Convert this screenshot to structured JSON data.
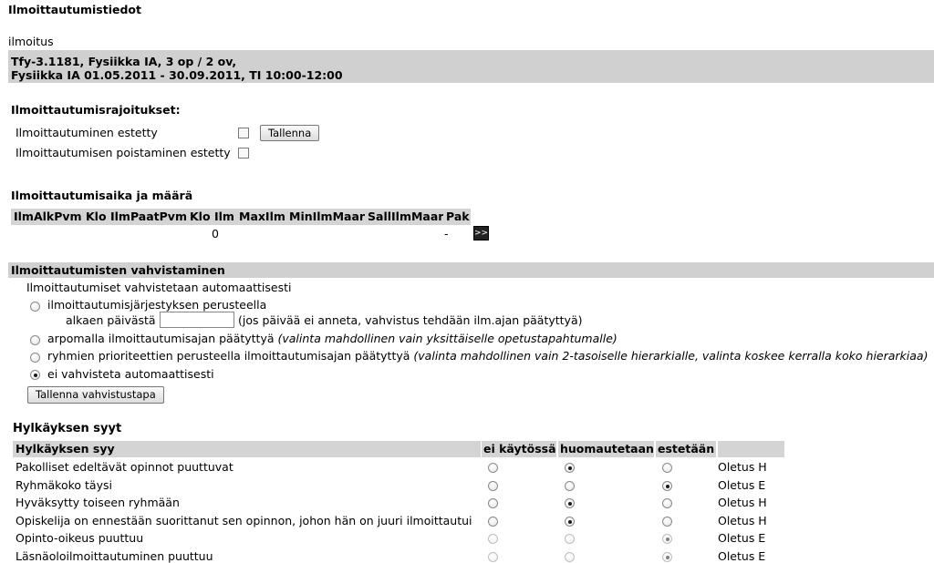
{
  "page_title": "Ilmoittautumistiedot",
  "subtitle": "ilmoitus",
  "course_info": {
    "line1": "Tfy-3.1181, Fysiikka IA, 3 op / 2 ov,",
    "line2": "Fysiikka IA 01.05.2011 - 30.09.2011, TI 10:00-12:00"
  },
  "restrictions": {
    "heading": "Ilmoittautumisrajoitukset:",
    "blocked_label": "Ilmoittautuminen estetty",
    "remove_blocked_label": "Ilmoittautumisen poistaminen estetty",
    "save_label": "Tallenna"
  },
  "period": {
    "heading": "Ilmoittautumisaika ja määrä",
    "columns": [
      "IlmAlkPvm",
      "Klo",
      "IlmPaatPvm",
      "Klo",
      "Ilm",
      "MaxIlm",
      "MinIlmMaar",
      "SallIlmMaar",
      "Pak"
    ],
    "row": {
      "ilm": "0",
      "pak": "-"
    },
    "next_label": ">>"
  },
  "confirmation": {
    "heading": "Ilmoittautumisten vahvistaminen",
    "intro": "Ilmoittautumiset vahvistetaan automaattisesti",
    "opt1": "ilmoittautumisjärjestyksen perusteella",
    "from_date_label": "alkaen päivästä",
    "from_date_value": "",
    "from_date_hint": "(jos päivää ei anneta, vahvistus tehdään ilm.ajan päätyttyä)",
    "opt2": "arpomalla ilmoittautumisajan päätyttyä",
    "opt2_note": "(valinta mahdollinen vain yksittäiselle opetustapahtumalle)",
    "opt3": "ryhmien prioriteettien perusteella ilmoittautumisajan päätyttyä",
    "opt3_note": "(valinta mahdollinen vain 2-tasoiselle hierarkialle, valinta koskee kerralla koko hierarkiaa)",
    "opt4": "ei vahvisteta automaattisesti",
    "selected": 4,
    "save_label": "Tallenna vahvistustapa"
  },
  "rejections": {
    "heading": "Hylkäyksen syyt",
    "columns": [
      "Hylkäyksen syy",
      "ei käytössä",
      "huomautetaan",
      "estetään"
    ],
    "rows": [
      {
        "reason": "Pakolliset edeltävät opinnot puuttuvat",
        "selected": 1,
        "default": "Oletus H",
        "disabled": false
      },
      {
        "reason": "Ryhmäkoko täysi",
        "selected": 2,
        "default": "Oletus E",
        "disabled": false
      },
      {
        "reason": "Hyväksytty toiseen ryhmään",
        "selected": 1,
        "default": "Oletus H",
        "disabled": false
      },
      {
        "reason": "Opiskelija on ennestään suorittanut sen opinnon, johon hän on juuri ilmoittautui",
        "selected": 1,
        "default": "Oletus H",
        "disabled": false
      },
      {
        "reason": "Opinto-oikeus puuttuu",
        "selected": 2,
        "default": "Oletus E",
        "disabled": true
      },
      {
        "reason": "Läsnäoloilmoittautuminen puuttuu",
        "selected": 2,
        "default": "Oletus E",
        "disabled": true
      }
    ]
  }
}
